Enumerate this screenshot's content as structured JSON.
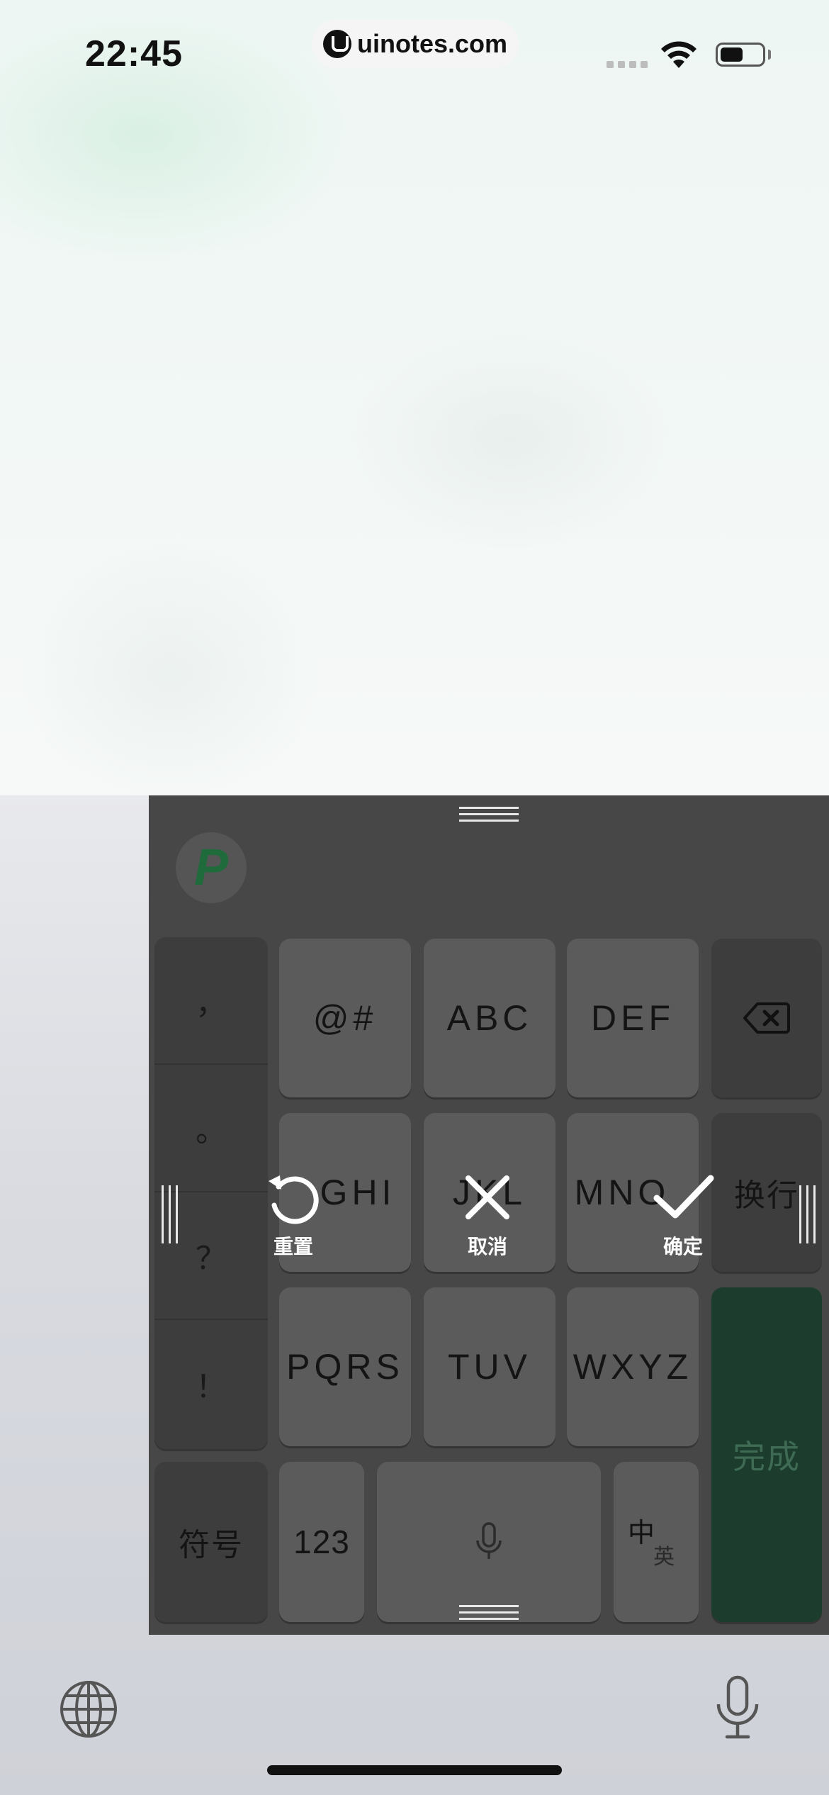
{
  "status_bar": {
    "time": "22:45",
    "url": "uinotes.com",
    "battery_level": 0.55
  },
  "keyboard": {
    "logo": "P",
    "punctuation": [
      "，",
      "。",
      "？",
      "！"
    ],
    "rows": [
      [
        "@#",
        "ABC",
        "DEF"
      ],
      [
        "GHI",
        "JKL",
        "MNO"
      ],
      [
        "PQRS",
        "TUV",
        "WXYZ"
      ]
    ],
    "newline_label": "换行",
    "done_label": "完成",
    "symbols_label": "符号",
    "numbers_label": "123",
    "lang_switch": {
      "primary": "中",
      "secondary": "英"
    },
    "overlay": {
      "reset_label": "重置",
      "cancel_label": "取消",
      "confirm_label": "确定"
    },
    "icons": {
      "backspace": "backspace-icon",
      "space_mic": "microphone-icon",
      "reset": "rotate-ccw-icon",
      "cancel": "close-icon",
      "confirm": "check-icon"
    }
  },
  "system_bar": {
    "icons": [
      "globe-icon",
      "microphone-icon"
    ]
  }
}
